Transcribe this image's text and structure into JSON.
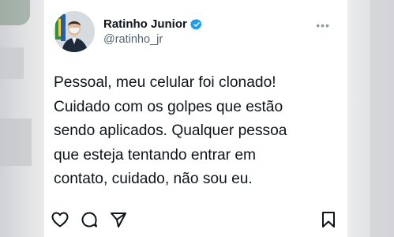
{
  "author": {
    "display_name": "Ratinho Junior",
    "handle": "@ratinho_jr",
    "verified": true
  },
  "menu": {
    "more_label": "•••"
  },
  "post": {
    "lines": [
      "Pessoal, meu celular foi clonado!",
      "Cuidado com os golpes que estão",
      "sendo aplicados. Qualquer pessoa",
      "que esteja tentando entrar em",
      "contato, cuidado, não sou eu."
    ]
  },
  "actions": {
    "icons": [
      "heart-icon",
      "comment-icon",
      "send-icon",
      "bookmark-icon"
    ]
  },
  "colors": {
    "text": "#0f1419",
    "secondary": "#536471",
    "verified": "#1d9bf0",
    "background": "#ffffff"
  }
}
